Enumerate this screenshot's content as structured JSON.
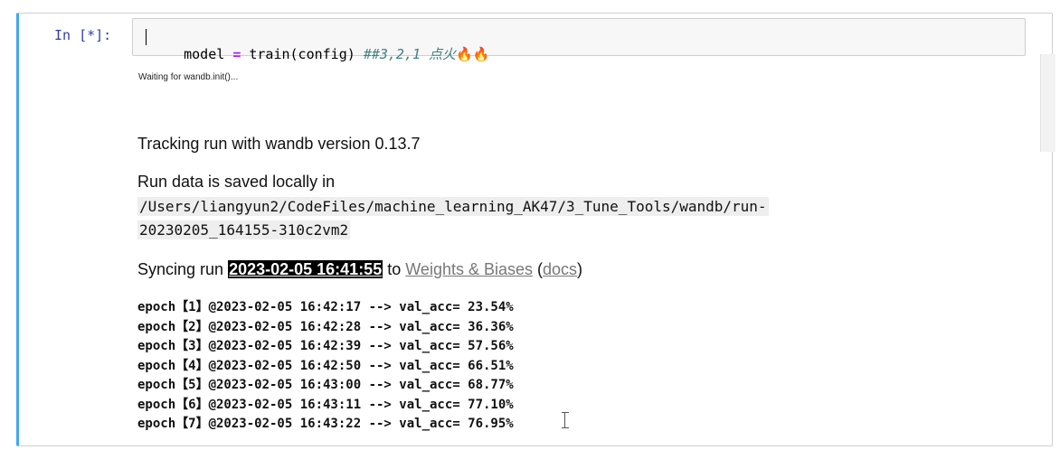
{
  "cell": {
    "prompt": "In [*]:",
    "code": {
      "var": "model",
      "op": "=",
      "call": "train(config)",
      "comment": "##3,2,1 点火",
      "fire_icons": "🔥🔥"
    }
  },
  "output": {
    "waiting": "Waiting for wandb.init()...",
    "tracking": "Tracking run with wandb version 0.13.7",
    "saved_label": "Run data is saved locally in",
    "path_line1": "/Users/liangyun2/CodeFiles/machine_learning_AK47/3_Tune_Tools/wandb/run-",
    "path_line2": "20230205_164155-310c2vm2",
    "sync_prefix": "Syncing run",
    "run_name": "2023-02-05 16:41:55",
    "sync_to": "to",
    "link_wb": "Weights & Biases",
    "paren_open": "(",
    "link_docs": "docs",
    "paren_close": ")",
    "log_lines": [
      "epoch【1】@2023-02-05 16:42:17 --> val_acc= 23.54%",
      "epoch【2】@2023-02-05 16:42:28 --> val_acc= 36.36%",
      "epoch【3】@2023-02-05 16:42:39 --> val_acc= 57.56%",
      "epoch【4】@2023-02-05 16:42:50 --> val_acc= 66.51%",
      "epoch【5】@2023-02-05 16:43:00 --> val_acc= 68.77%",
      "epoch【6】@2023-02-05 16:43:11 --> val_acc= 77.10%",
      "epoch【7】@2023-02-05 16:43:22 --> val_acc= 76.95%"
    ]
  },
  "colors": {
    "cell_border_active": "#42a5f5",
    "prompt": "#303f9f",
    "comment": "#408080",
    "operator": "#aa22ff"
  }
}
